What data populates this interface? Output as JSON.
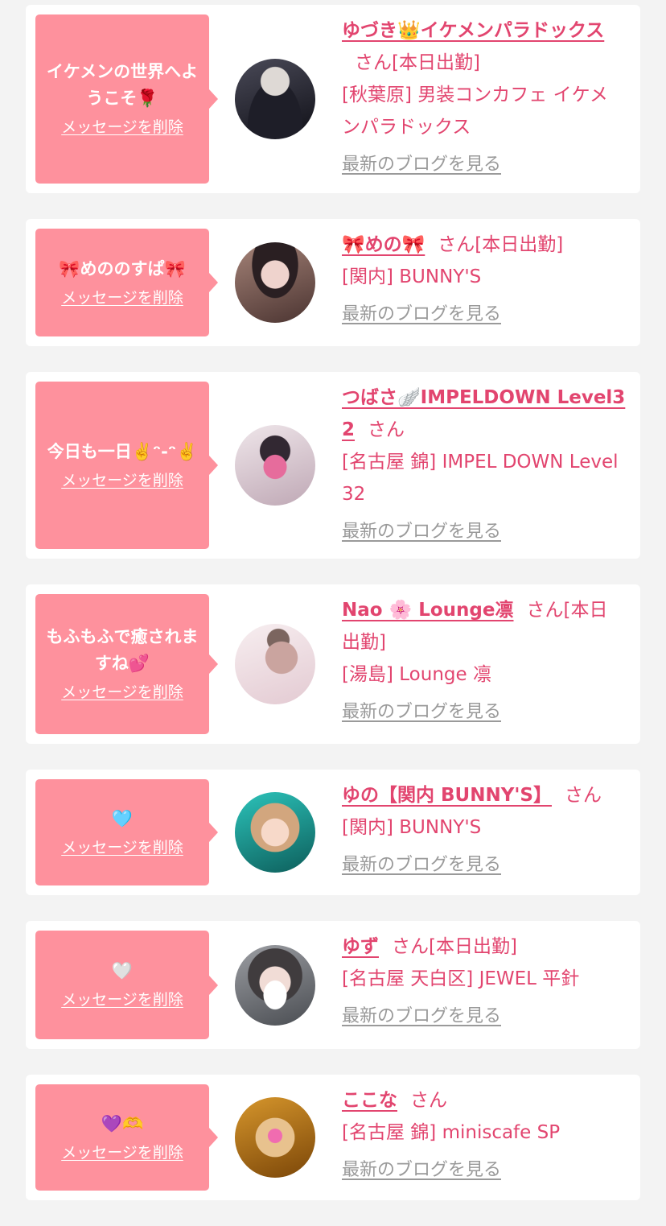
{
  "delete_label": "メッセージを削除",
  "blog_label": "最新のブログを見る",
  "san": "さん",
  "on_duty": "[本日出勤]",
  "entries": [
    {
      "message": "イケメンの世界へようこそ🌹",
      "name": "ゆづき👑イケメンパラドックス",
      "on_duty": true,
      "shop": "[秋葉原] 男装コンカフェ イケメンパラドックス"
    },
    {
      "message": "🎀めののすぱ🎀",
      "name": "🎀めの🎀",
      "on_duty": true,
      "shop": "[関内] BUNNY'S"
    },
    {
      "message": "今日も一日✌️ᵔ-ᵔ✌️",
      "name": "つばさ🪽IMPELDOWN Level32",
      "on_duty": false,
      "shop": "[名古屋 錦] IMPEL DOWN Level32"
    },
    {
      "message": "もふもふで癒されますね💕",
      "name": "Nao 🌸 Lounge凛",
      "on_duty": true,
      "shop": "[湯島] Lounge 凛"
    },
    {
      "message": "🩵",
      "name": "ゆの【関内 BUNNY'S】",
      "on_duty": false,
      "shop": "[関内] BUNNY'S"
    },
    {
      "message": "🤍",
      "name": "ゆず",
      "on_duty": true,
      "shop": "[名古屋 天白区] JEWEL 平針"
    },
    {
      "message": "💜🫶",
      "name": "ここな",
      "on_duty": false,
      "shop": "[名古屋 錦] miniscafe SP"
    }
  ],
  "colors": {
    "page_background": "#f3f3f3",
    "card_background": "#ffffff",
    "bubble": "#fe919d",
    "accent_text": "#e2456f",
    "blog_link": "#9a9a9a"
  }
}
